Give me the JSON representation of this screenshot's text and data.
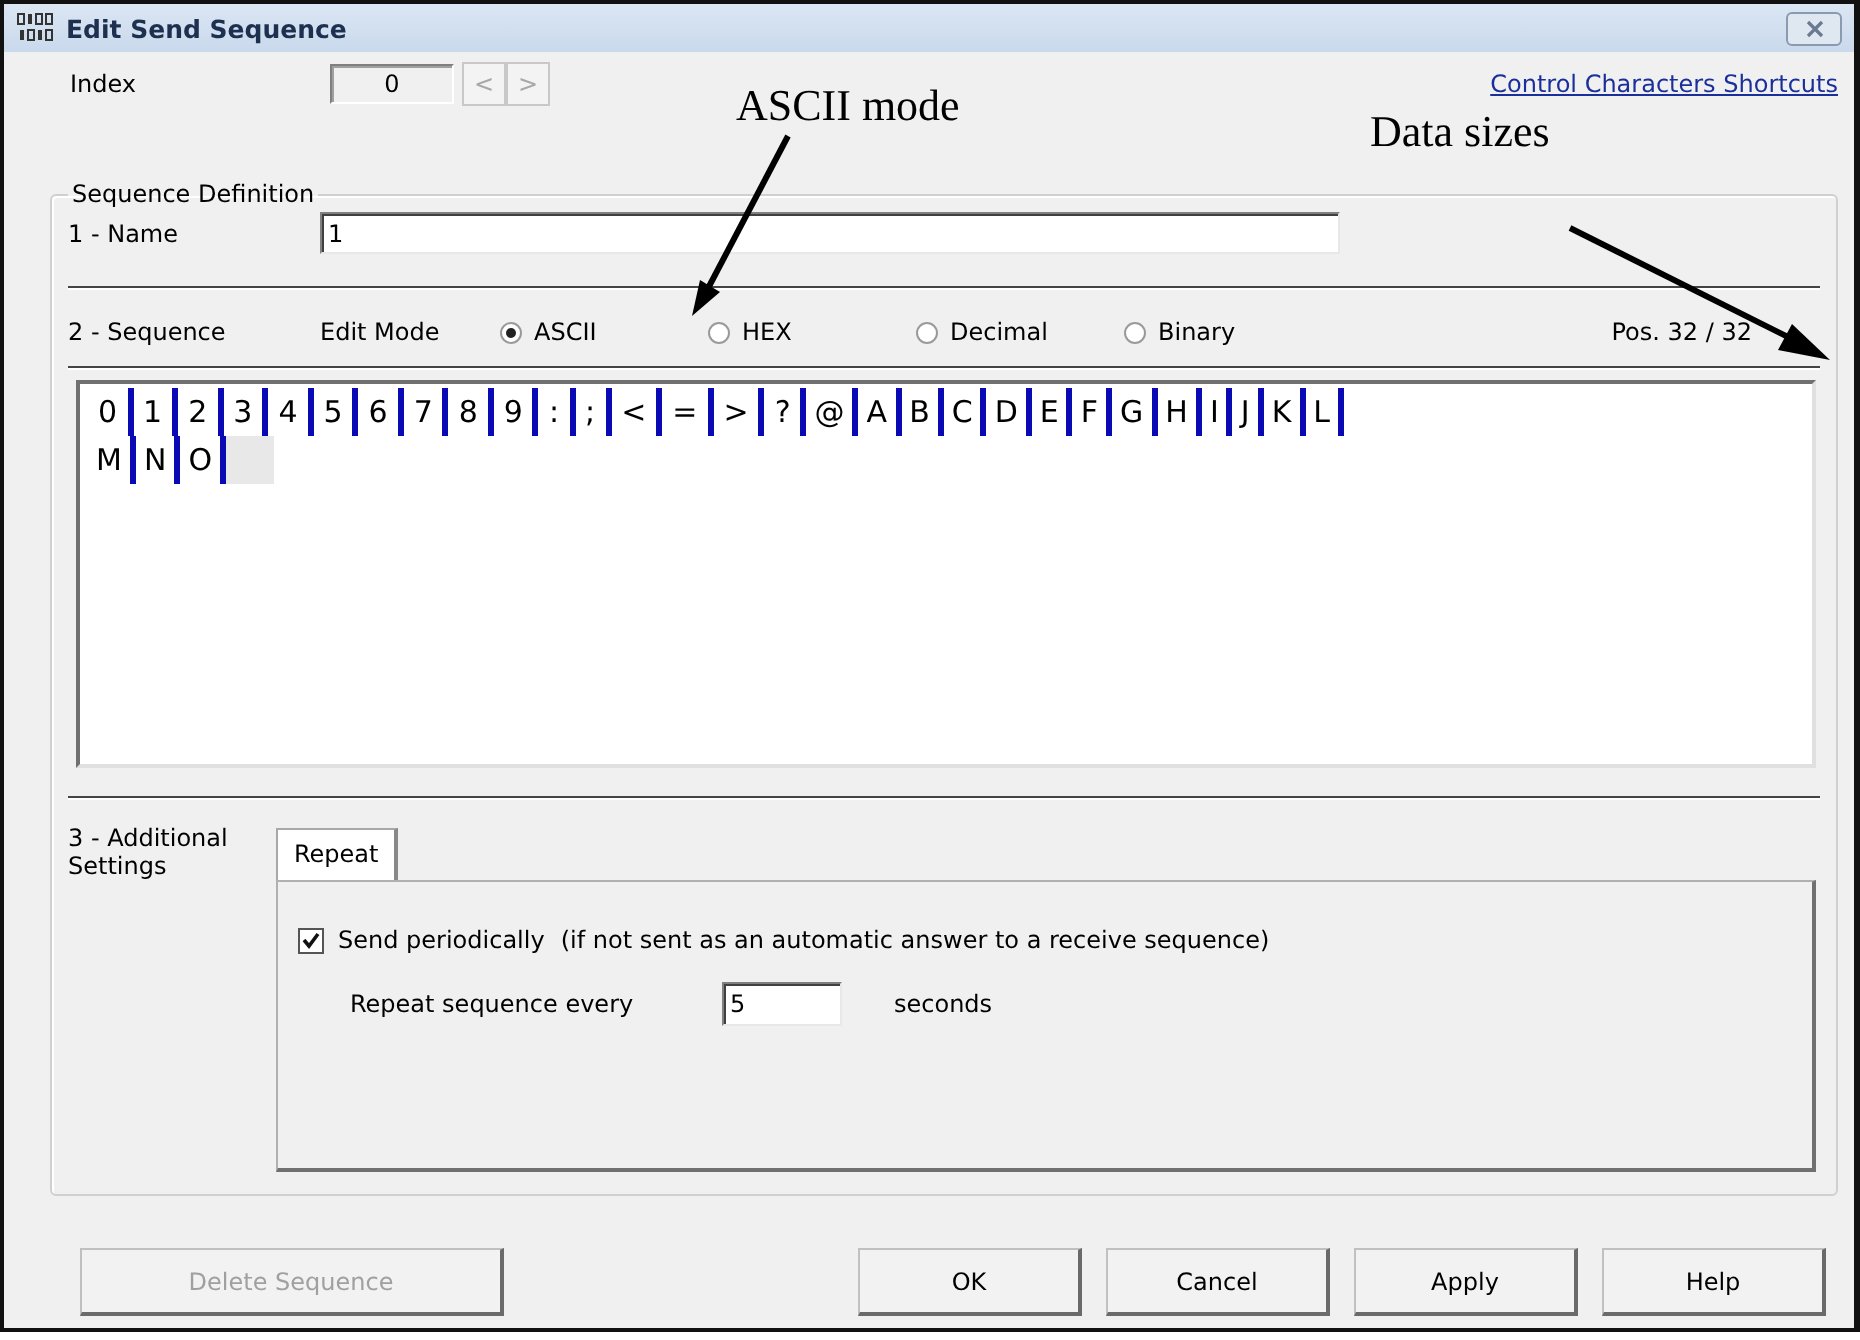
{
  "window": {
    "title": "Edit Send Sequence"
  },
  "index": {
    "label": "Index",
    "value": "0",
    "prev": "<",
    "next": ">",
    "nav_disabled": true
  },
  "link": "Control Characters Shortcuts",
  "group": {
    "title": "Sequence Definition"
  },
  "name": {
    "label": "1 - Name",
    "value": "1"
  },
  "sequence": {
    "label": "2 - Sequence",
    "edit_mode_label": "Edit Mode",
    "modes": [
      {
        "label": "ASCII",
        "selected": true
      },
      {
        "label": "HEX",
        "selected": false
      },
      {
        "label": "Decimal",
        "selected": false
      },
      {
        "label": "Binary",
        "selected": false
      }
    ],
    "position": "Pos. 32 / 32",
    "lines": [
      [
        "0",
        "1",
        "2",
        "3",
        "4",
        "5",
        "6",
        "7",
        "8",
        "9",
        ":",
        ";",
        "<",
        "=",
        ">",
        "?",
        "@",
        "A",
        "B",
        "C",
        "D",
        "E",
        "F",
        "G",
        "H",
        "I",
        "J",
        "K",
        "L"
      ],
      [
        "M",
        "N",
        "O"
      ]
    ]
  },
  "additional": {
    "label": "3 - Additional Settings",
    "tabs": [
      {
        "label": "Repeat",
        "selected": true
      }
    ],
    "send_periodically": {
      "label": "Send periodically",
      "note": "(if not sent as an automatic answer to a receive sequence)",
      "checked": true
    },
    "repeat": {
      "label": "Repeat sequence every",
      "value": "5",
      "unit": "seconds"
    }
  },
  "buttons": [
    {
      "label": "Delete Sequence",
      "disabled": true
    },
    {
      "label": "OK",
      "disabled": false
    },
    {
      "label": "Cancel",
      "disabled": false
    },
    {
      "label": "Apply",
      "disabled": false
    },
    {
      "label": "Help",
      "disabled": false
    }
  ],
  "annotations": [
    {
      "text": "ASCII mode"
    },
    {
      "text": "Data sizes"
    }
  ]
}
